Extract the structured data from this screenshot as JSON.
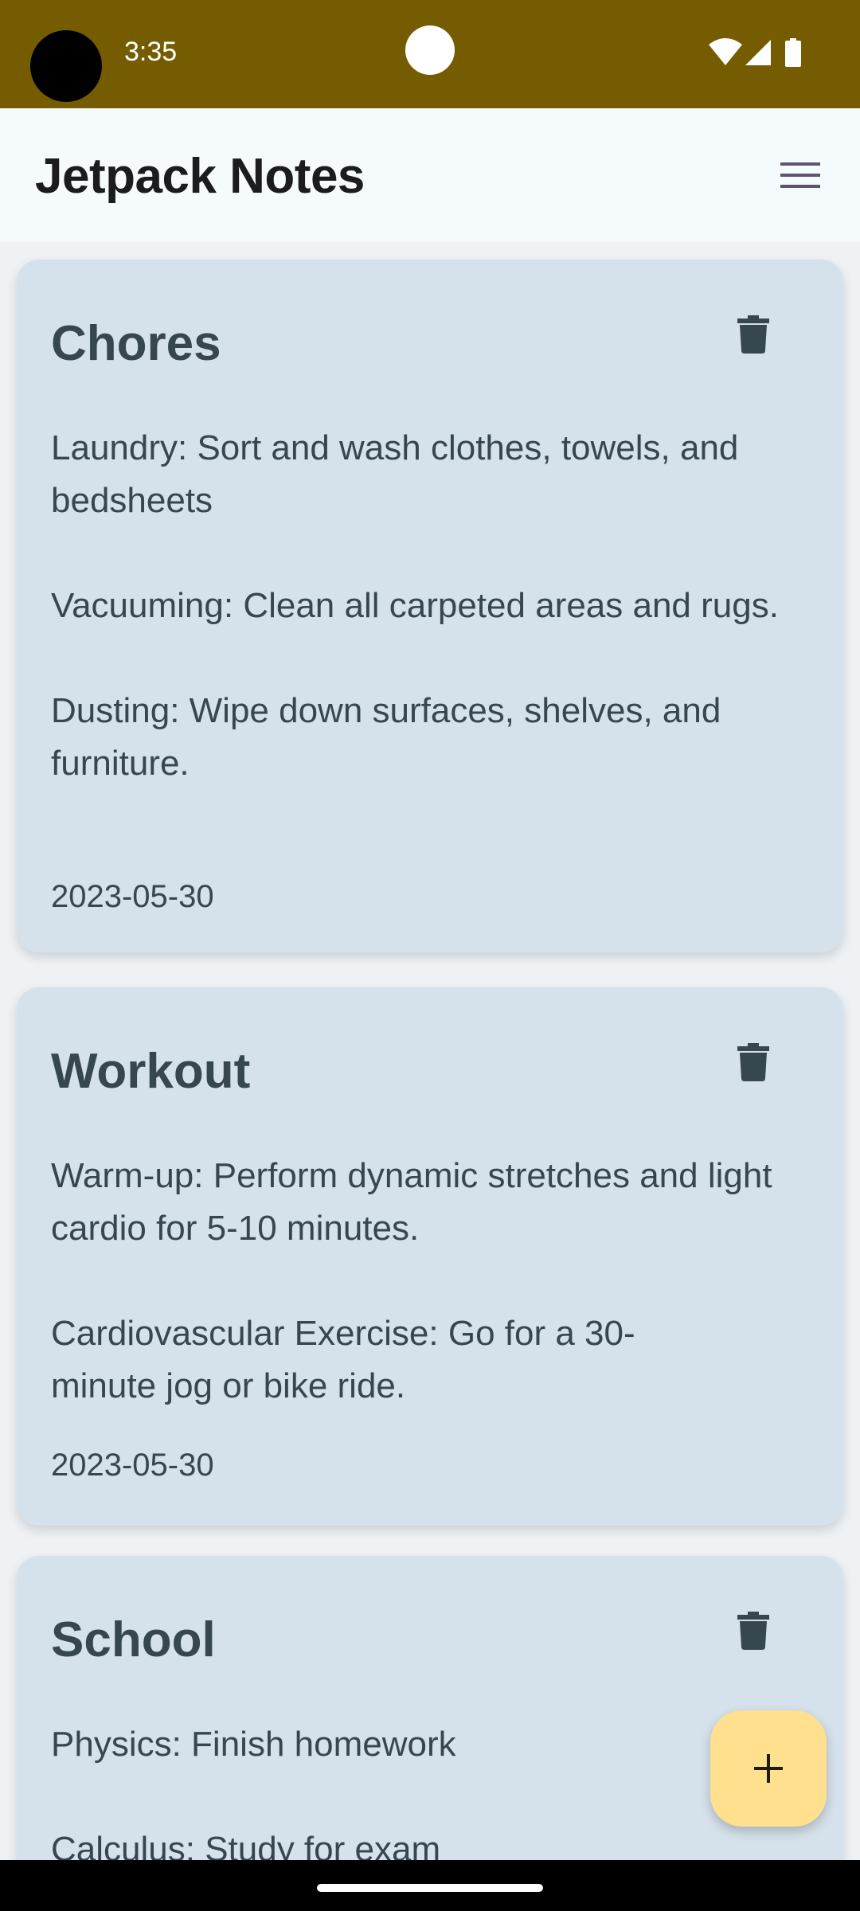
{
  "status_bar": {
    "time": "3:35",
    "icons": [
      "wifi-icon",
      "cellular-signal-icon",
      "battery-icon"
    ],
    "background": "#765C00"
  },
  "app_bar": {
    "title": "Jetpack Notes",
    "menu_icon": "menu-icon"
  },
  "notes": [
    {
      "title": "Chores",
      "paragraphs": [
        "Laundry: Sort and wash clothes, towels, and bedsheets",
        "Vacuuming: Clean all carpeted areas and rugs.",
        "Dusting: Wipe down surfaces, shelves, and furniture."
      ],
      "date": "2023-05-30"
    },
    {
      "title": "Workout",
      "paragraphs": [
        "Warm-up: Perform dynamic stretches and light cardio for 5-10 minutes.",
        "Cardiovascular Exercise: Go for a 30-minute jog or bike ride."
      ],
      "date": "2023-05-30"
    },
    {
      "title": "School",
      "paragraphs": [
        "Physics: Finish homework",
        "Calculus: Study for exam"
      ]
    }
  ],
  "fab": {
    "icon": "plus-icon"
  },
  "colors": {
    "card": "#D6E2EB",
    "card_text": "#37474F",
    "fab": "#FFE08F"
  }
}
